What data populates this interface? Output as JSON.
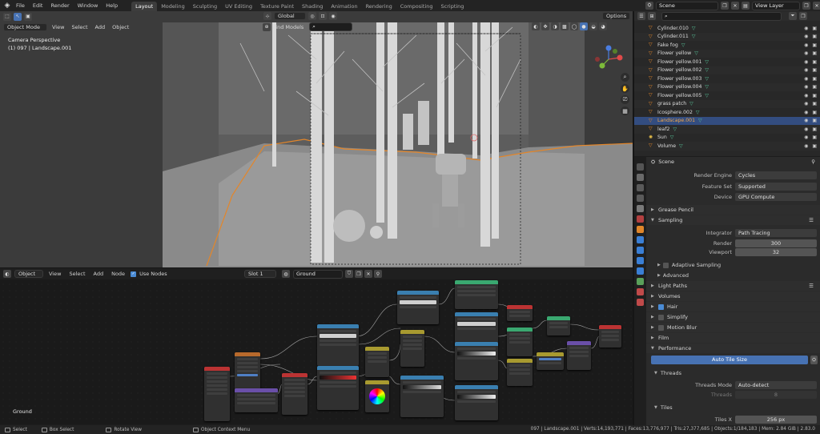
{
  "topbar": {
    "menus": [
      "File",
      "Edit",
      "Render",
      "Window",
      "Help"
    ],
    "workspaces": [
      "Layout",
      "Modeling",
      "Sculpting",
      "UV Editing",
      "Texture Paint",
      "Shading",
      "Animation",
      "Rendering",
      "Compositing",
      "Scripting"
    ],
    "active_workspace": "Layout",
    "scene": "Scene",
    "view_layer": "View Layer"
  },
  "viewport": {
    "mode": "Object Mode",
    "menus": [
      "View",
      "Select",
      "Add",
      "Object"
    ],
    "transform_orientation": "Global",
    "find_models": "Find Models",
    "options": "Options",
    "camera_label": "Camera Perspective",
    "object_label": "(1) 097 | Landscape.001"
  },
  "node_editor": {
    "type": "Object",
    "menus": [
      "View",
      "Select",
      "Add",
      "Node"
    ],
    "use_nodes": "Use Nodes",
    "slot": "Slot 1",
    "material": "Ground",
    "footer_label": "Ground"
  },
  "outliner": {
    "rows": [
      {
        "name": "Cylinder.010",
        "selected": false
      },
      {
        "name": "Cylinder.011",
        "selected": false
      },
      {
        "name": "Fake fog",
        "selected": false
      },
      {
        "name": "Flower yellow",
        "selected": false
      },
      {
        "name": "Flower yellow.001",
        "selected": false
      },
      {
        "name": "Flower yellow.002",
        "selected": false
      },
      {
        "name": "Flower yellow.003",
        "selected": false
      },
      {
        "name": "Flower yellow.004",
        "selected": false
      },
      {
        "name": "Flower yellow.005",
        "selected": false
      },
      {
        "name": "grass patch",
        "selected": false
      },
      {
        "name": "Icosphere.002",
        "selected": false
      },
      {
        "name": "Landscape.001",
        "selected": true
      },
      {
        "name": "leaf2",
        "selected": false
      },
      {
        "name": "Sun",
        "selected": false
      },
      {
        "name": "Volume",
        "selected": false
      }
    ]
  },
  "properties": {
    "header": "Scene",
    "render_engine_label": "Render Engine",
    "render_engine": "Cycles",
    "feature_set_label": "Feature Set",
    "feature_set": "Supported",
    "device_label": "Device",
    "device": "GPU Compute",
    "grease_pencil": "Grease Pencil",
    "sampling": "Sampling",
    "integrator_label": "Integrator",
    "integrator": "Path Tracing",
    "render_label": "Render",
    "render_samples": "300",
    "viewport_label": "Viewport",
    "viewport_samples": "32",
    "adaptive_sampling": "Adaptive Sampling",
    "advanced": "Advanced",
    "light_paths": "Light Paths",
    "volumes": "Volumes",
    "hair": "Hair",
    "simplify": "Simplify",
    "motion_blur": "Motion Blur",
    "film": "Film",
    "performance": "Performance",
    "auto_tile_size": "Auto Tile Size",
    "threads": "Threads",
    "threads_mode_label": "Threads Mode",
    "threads_mode": "Auto-detect",
    "threads_label": "Threads",
    "threads_value": "8",
    "tiles": "Tiles",
    "tiles_x_label": "Tiles X",
    "tiles_x": "256 px"
  },
  "statusbar": {
    "select": "Select",
    "box_select": "Box Select",
    "rotate_view": "Rotate View",
    "context_menu": "Object Context Menu",
    "stats": "097 | Landscape.001 | Verts:14,193,771 | Faces:13,776,977 | Tris:27,377,685 | Objects:1/184,183 | Mem: 2.84 GiB | 2.83.0"
  },
  "colors": {
    "accent": "#4772b3",
    "selection": "#334d80",
    "active_object": "#e3862a"
  }
}
